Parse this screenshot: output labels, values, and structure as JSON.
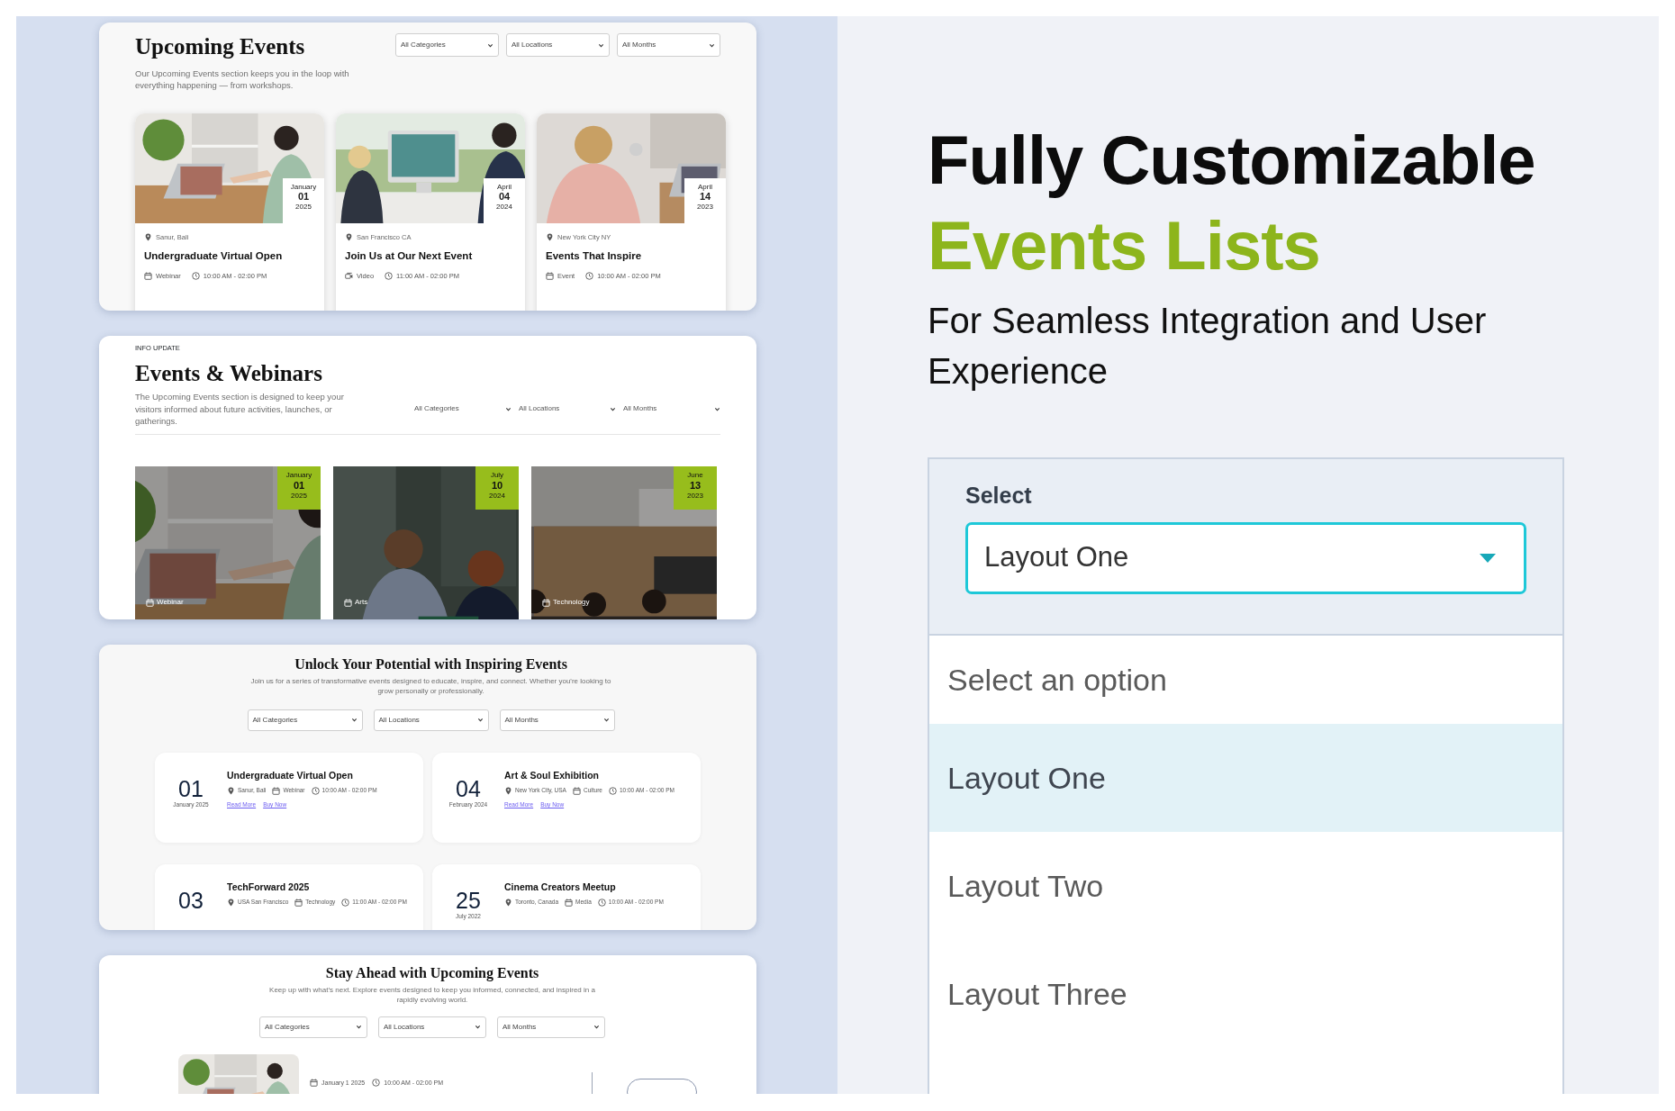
{
  "upcoming_events": {
    "title": "Upcoming Events",
    "description": "Our Upcoming Events section keeps you in the loop with everything happening — from workshops.",
    "filters": [
      "All Categories",
      "All Locations",
      "All Months"
    ],
    "cards": [
      {
        "month": "January",
        "day": "01",
        "year": "2025",
        "location": "Sanur, Bali",
        "title": "Undergraduate Virtual Open",
        "kind": "calendar",
        "category": "Webinar",
        "time": "10:00 AM - 02:00 PM"
      },
      {
        "month": "April",
        "day": "04",
        "year": "2024",
        "location": "San Francisco CA",
        "title": "Join Us at Our Next Event",
        "kind": "video",
        "category": "Video",
        "time": "11:00 AM - 02:00 PM"
      },
      {
        "month": "April",
        "day": "14",
        "year": "2023",
        "location": "New York City NY",
        "title": "Events That Inspire",
        "kind": "calendar",
        "category": "Event",
        "time": "10:00 AM - 02:00 PM"
      }
    ]
  },
  "events_webinars": {
    "eyebrow": "INFO UPDATE",
    "title": "Events & Webinars",
    "description": "The Upcoming Events section is designed to keep your visitors informed about future activities, launches, or gatherings.",
    "filters": [
      "All Categories",
      "All Locations",
      "All Months"
    ],
    "cards": [
      {
        "month": "January",
        "day": "01",
        "year": "2025",
        "category": "Webinar"
      },
      {
        "month": "July",
        "day": "10",
        "year": "2024",
        "category": "Arts"
      },
      {
        "month": "June",
        "day": "13",
        "year": "2023",
        "category": "Technology"
      }
    ]
  },
  "inspiring_events": {
    "title": "Unlock Your Potential with Inspiring Events",
    "description": "Join us for a series of transformative events designed to educate, inspire, and connect. Whether you're looking to grow personally or professionally.",
    "filters": [
      "All Categories",
      "All Locations",
      "All Months"
    ],
    "events": [
      {
        "day": "01",
        "month_year": "January 2025",
        "title": "Undergraduate Virtual Open",
        "location": "Sanur, Bali",
        "category": "Webinar",
        "time": "10:00 AM - 02:00 PM",
        "links": [
          "Read More",
          "Buy Now"
        ]
      },
      {
        "day": "04",
        "month_year": "February 2024",
        "title": "Art & Soul Exhibition",
        "location": "New York City, USA",
        "category": "Culture",
        "time": "10:00 AM - 02:00 PM",
        "links": [
          "Read More",
          "Buy Now"
        ]
      },
      {
        "day": "03",
        "title": "TechForward 2025",
        "location": "USA San Francisco",
        "category": "Technology",
        "time": "11:00 AM - 02:00 PM"
      },
      {
        "day": "25",
        "month_year": "July 2022",
        "title": "Cinema Creators Meetup",
        "location": "Toronto, Canada",
        "category": "Media",
        "time": "10:00 AM - 02:00 PM"
      }
    ]
  },
  "stay_ahead": {
    "title": "Stay Ahead with Upcoming Events",
    "description": "Keep up with what’s next. Explore events designed to keep you informed, connected, and inspired in a rapidly evolving world.",
    "filters": [
      "All Categories",
      "All Locations",
      "All Months"
    ],
    "items": [
      {
        "date": "January 1 2025",
        "time": "10:00 AM - 02:00 PM"
      }
    ]
  },
  "promo": {
    "title_line1": "Fully Customizable",
    "title_line2": "Events Lists",
    "subtitle": "For Seamless Integration and User Experience"
  },
  "select_demo": {
    "label": "Select",
    "value": "Layout One",
    "options": [
      {
        "label": "Select an option",
        "selected": false
      },
      {
        "label": "Layout One",
        "selected": true
      },
      {
        "label": "Layout Two",
        "selected": false
      },
      {
        "label": "Layout Three",
        "selected": false
      }
    ]
  }
}
